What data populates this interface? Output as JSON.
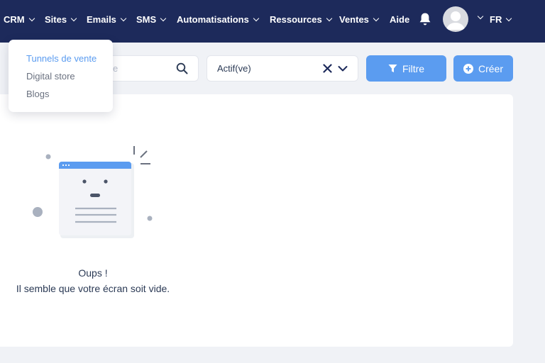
{
  "nav": {
    "items": [
      {
        "label": "CRM"
      },
      {
        "label": "Sites"
      },
      {
        "label": "Emails"
      },
      {
        "label": "SMS"
      },
      {
        "label": "Automatisations"
      },
      {
        "label": "Ressources"
      },
      {
        "label": "Ventes"
      },
      {
        "label": "Aide"
      }
    ],
    "language": "FR"
  },
  "sites_menu": {
    "items": [
      {
        "label": "Tunnels de vente",
        "active": true
      },
      {
        "label": "Digital store"
      },
      {
        "label": "Blogs"
      }
    ]
  },
  "toolbar": {
    "search_placeholder_tail": "e",
    "status_value": "Actif(ve)",
    "filter_label": "Filtre",
    "create_label": "Créer"
  },
  "empty_state": {
    "title": "Oups !",
    "subtitle": "Il semble que votre écran soit vide."
  },
  "colors": {
    "nav_bg": "#1d2a5b",
    "accent": "#5b9cf0",
    "text": "#2b3a55",
    "page_bg": "#f0f2f6"
  }
}
